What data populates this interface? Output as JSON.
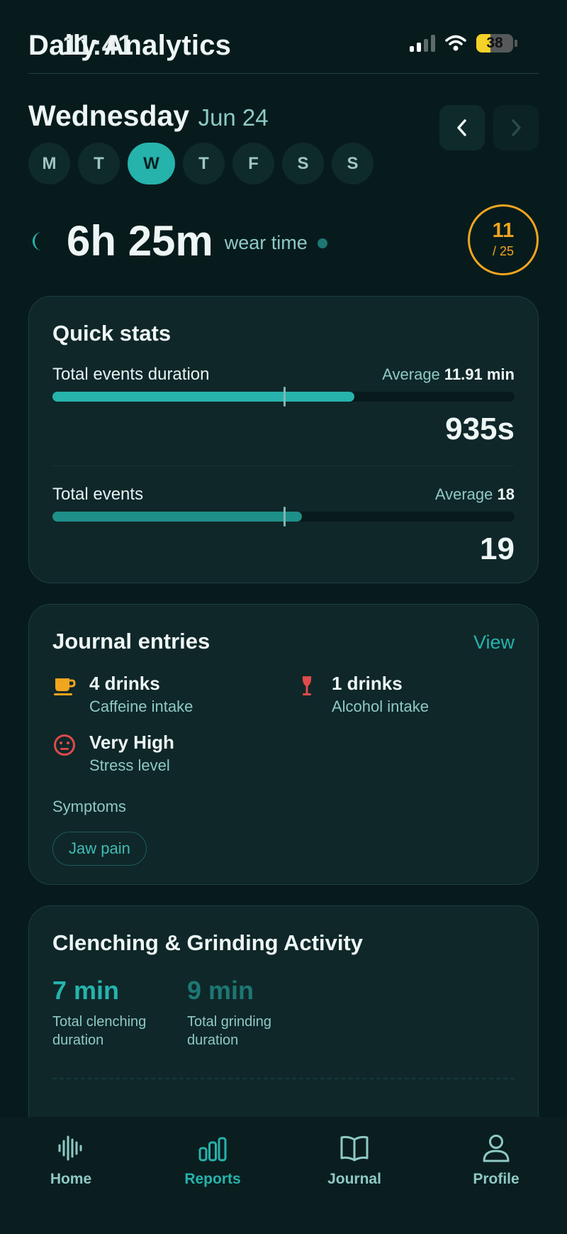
{
  "status_bar": {
    "time": "11:41",
    "battery": "38",
    "battery_fraction": 0.38
  },
  "header": {
    "title": "Daily Analytics"
  },
  "date": {
    "weekday": "Wednesday",
    "month_day": "Jun 24"
  },
  "week": {
    "days": [
      "M",
      "T",
      "W",
      "T",
      "F",
      "S",
      "S"
    ],
    "active_index": 2
  },
  "wear": {
    "value": "6h 25m",
    "label": "wear time"
  },
  "score": {
    "value": "11",
    "total": "/ 25"
  },
  "quick_stats": {
    "title": "Quick stats",
    "duration": {
      "label": "Total events duration",
      "avg_prefix": "Average",
      "avg_value": "11.91 min",
      "value": "935s",
      "fill_fraction": 0.654,
      "avg_fraction": 0.5
    },
    "events": {
      "label": "Total events",
      "avg_prefix": "Average",
      "avg_value": "18",
      "value": "19",
      "fill_fraction": 0.54,
      "avg_fraction": 0.5
    }
  },
  "journal": {
    "title": "Journal entries",
    "view_label": "View",
    "entries": [
      {
        "icon": "cup-icon",
        "value": "4 drinks",
        "label": "Caffeine intake",
        "color": "#f2a51f"
      },
      {
        "icon": "wine-glass-icon",
        "value": "1 drinks",
        "label": "Alcohol intake",
        "color": "#e04a4a"
      },
      {
        "icon": "stress-face-icon",
        "value": "Very High",
        "label": "Stress level",
        "color": "#e04a4a"
      }
    ],
    "symptoms_label": "Symptoms",
    "symptoms": [
      "Jaw pain"
    ]
  },
  "activity": {
    "title": "Clenching & Grinding Activity",
    "clenching": {
      "value": "7 min",
      "label": "Total clenching duration",
      "color": "#26b3ac"
    },
    "grinding": {
      "value": "9 min",
      "label": "Total grinding duration",
      "color": "#1d7773"
    }
  },
  "bottom_nav": {
    "items": [
      {
        "label": "Home",
        "icon": "waveform-icon"
      },
      {
        "label": "Reports",
        "icon": "bars-icon"
      },
      {
        "label": "Journal",
        "icon": "book-icon"
      },
      {
        "label": "Profile",
        "icon": "person-icon"
      }
    ],
    "active_index": 1
  },
  "colors": {
    "accent": "#26b3ac",
    "accent_dark": "#1d7773",
    "warning": "#f2a51f",
    "danger": "#e04a4a",
    "background": "#071b1d"
  }
}
